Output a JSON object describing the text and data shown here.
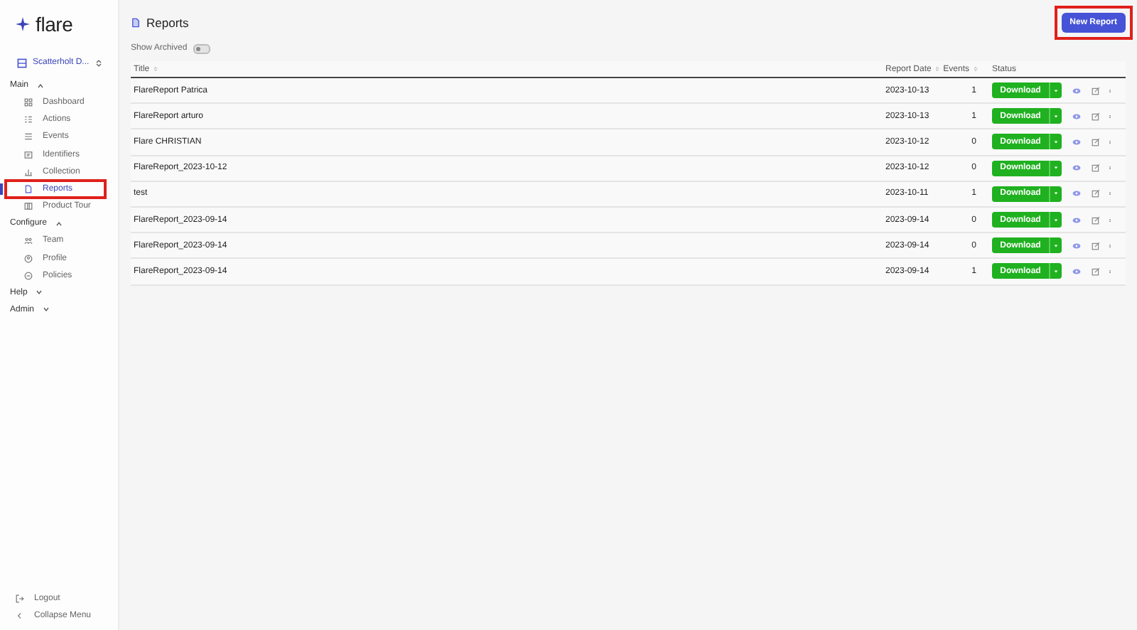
{
  "sidebar": {
    "logo": "flare",
    "workspace": "Scatterholt D...",
    "sections": [
      {
        "label": "Main",
        "expanded": true,
        "items": [
          {
            "label": "Dashboard",
            "selected": false,
            "highlighted": false
          },
          {
            "label": "Actions",
            "selected": false,
            "highlighted": false
          },
          {
            "label": "Events",
            "selected": false,
            "highlighted": false
          },
          {
            "label": "Identifiers",
            "selected": false,
            "highlighted": false
          },
          {
            "label": "Collection",
            "selected": false,
            "highlighted": false
          },
          {
            "label": "Reports",
            "selected": true,
            "highlighted": true
          },
          {
            "label": "Product Tour",
            "selected": false,
            "highlighted": false
          }
        ]
      },
      {
        "label": "Configure",
        "expanded": true,
        "items": [
          {
            "label": "Team",
            "selected": false,
            "highlighted": false
          },
          {
            "label": "Profile",
            "selected": false,
            "highlighted": false
          },
          {
            "label": "Policies",
            "selected": false,
            "highlighted": false
          }
        ]
      },
      {
        "label": "Help",
        "expanded": false
      },
      {
        "label": "Admin",
        "expanded": false
      }
    ],
    "footer": [
      "Logout",
      "Collapse Menu"
    ]
  },
  "page": {
    "title": "Reports",
    "new_button": {
      "label": "New Report",
      "highlighted": true
    },
    "show_archived": {
      "label": "Show Archived",
      "on": false
    }
  },
  "table": {
    "columns": [
      "Title",
      "Report Date",
      "Events",
      "Status"
    ],
    "rows": [
      {
        "title": "FlareReport Patrica",
        "date": "2023-10-13",
        "events": "1",
        "action": "Download"
      },
      {
        "title": "FlareReport arturo",
        "date": "2023-10-13",
        "events": "1",
        "action": "Download"
      },
      {
        "title": "Flare CHRISTIAN",
        "date": "2023-10-12",
        "events": "0",
        "action": "Download"
      },
      {
        "title": "FlareReport_2023-10-12",
        "date": "2023-10-12",
        "events": "0",
        "action": "Download"
      },
      {
        "title": "test",
        "date": "2023-10-11",
        "events": "1",
        "action": "Download"
      },
      {
        "title": "FlareReport_2023-09-14",
        "date": "2023-09-14",
        "events": "0",
        "action": "Download"
      },
      {
        "title": "FlareReport_2023-09-14",
        "date": "2023-09-14",
        "events": "0",
        "action": "Download"
      },
      {
        "title": "FlareReport_2023-09-14",
        "date": "2023-09-14",
        "events": "1",
        "action": "Download"
      }
    ]
  }
}
